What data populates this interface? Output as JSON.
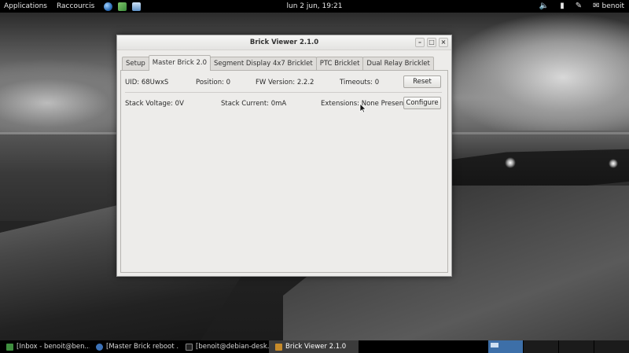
{
  "top_panel": {
    "applications_label": "Applications",
    "places_label": "Raccourcis",
    "launchers": [
      "browser-globe-icon",
      "map-icon",
      "monitor-icon"
    ],
    "clock": "lun  2 jun, 19:21",
    "tray": [
      "volume-icon",
      "battery-icon",
      "chat-icon"
    ],
    "username": "benoit"
  },
  "window": {
    "title": "Brick Viewer 2.1.0",
    "controls": [
      "minimize",
      "maximize",
      "close"
    ],
    "tabs": [
      {
        "label": "Setup",
        "active": false
      },
      {
        "label": "Master Brick 2.0",
        "active": true
      },
      {
        "label": "Segment Display 4x7 Bricklet",
        "active": false
      },
      {
        "label": "PTC Bricklet",
        "active": false
      },
      {
        "label": "Dual Relay Bricklet",
        "active": false
      }
    ],
    "master": {
      "uid": "UID: 68UwxS",
      "position": "Position: 0",
      "fw_version": "FW Version: 2.2.2",
      "timeouts": "Timeouts: 0",
      "reset_label": "Reset",
      "stack_voltage": "Stack Voltage: 0V",
      "stack_current": "Stack Current: 0mA",
      "extensions": "Extensions: None Present",
      "configure_label": "Configure"
    }
  },
  "taskbar": {
    "tasks": [
      {
        "label": "[Inbox - benoit@ben...",
        "icon": "mail-icon",
        "active": false
      },
      {
        "label": "[Master Brick reboot ...",
        "icon": "chat-icon",
        "active": false
      },
      {
        "label": "[benoit@debian-desk...",
        "icon": "terminal-icon",
        "active": false
      },
      {
        "label": "Brick Viewer 2.1.0",
        "icon": "brickv-icon",
        "active": true
      }
    ],
    "workspaces": 4,
    "current_workspace": 1
  },
  "colors": {
    "panel": "#000000",
    "window_bg": "#edecea",
    "workspace_active": "#3d6fa8"
  }
}
